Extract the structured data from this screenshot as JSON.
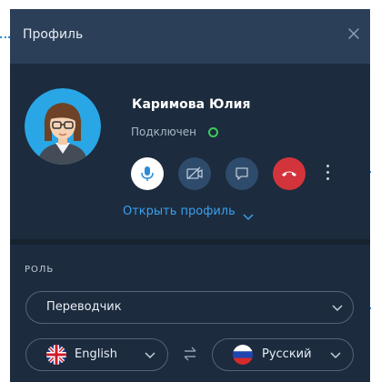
{
  "header": {
    "title": "Профиль",
    "close_icon": "close-icon"
  },
  "user": {
    "name": "Каримова Юлия",
    "status": "Подключен",
    "status_color": "#3bcb5e"
  },
  "actions": [
    {
      "icon": "microphone-icon",
      "color": "#ffffff",
      "active": true
    },
    {
      "icon": "video-off-icon",
      "color": "#2f4b6b",
      "active": false
    },
    {
      "icon": "chat-icon",
      "color": "#2f4b6b",
      "active": false
    },
    {
      "icon": "hangup-icon",
      "color": "#d3343b",
      "active": false
    },
    {
      "icon": "more-vertical-icon"
    }
  ],
  "open_profile": {
    "label": "Открыть профиль"
  },
  "role": {
    "section_label": "РОЛЬ",
    "selected": "Переводчик"
  },
  "languages": {
    "source": {
      "label": "English",
      "flag": "uk-flag-icon"
    },
    "target": {
      "label": "Русский",
      "flag": "russia-flag-icon"
    },
    "swap_icon": "swap-icon"
  },
  "colors": {
    "accent": "#2a8bd8",
    "link": "#3aa0ef",
    "panel_bg": "#1c2b3d",
    "header_bg": "#2b3f58"
  }
}
